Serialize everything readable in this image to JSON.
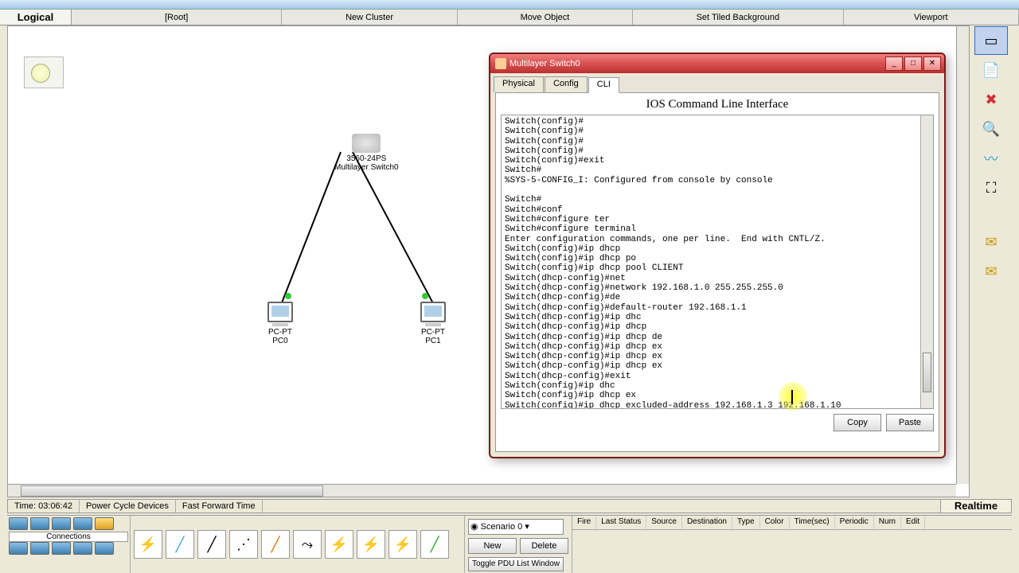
{
  "tabs": {
    "logical": "Logical",
    "root": "[Root]",
    "new_cluster": "New Cluster",
    "move_object": "Move Object",
    "set_tiled_bg": "Set Tiled Background",
    "viewport": "Viewport"
  },
  "devices": {
    "switch": {
      "model": "3560-24PS",
      "name": "Multilayer Switch0"
    },
    "pc0": {
      "type": "PC-PT",
      "name": "PC0"
    },
    "pc1": {
      "type": "PC-PT",
      "name": "PC1"
    }
  },
  "dialog": {
    "title": "Multilayer Switch0",
    "tabs": {
      "physical": "Physical",
      "config": "Config",
      "cli": "CLI"
    },
    "heading": "IOS Command Line Interface",
    "copy": "Copy",
    "paste": "Paste",
    "cli_lines": [
      "Switch(config)#",
      "Switch(config)#",
      "Switch(config)#",
      "Switch(config)#",
      "Switch(config)#exit",
      "Switch#",
      "%SYS-5-CONFIG_I: Configured from console by console",
      "",
      "Switch#",
      "Switch#conf",
      "Switch#configure ter",
      "Switch#configure terminal",
      "Enter configuration commands, one per line.  End with CNTL/Z.",
      "Switch(config)#ip dhcp",
      "Switch(config)#ip dhcp po",
      "Switch(config)#ip dhcp pool CLIENT",
      "Switch(dhcp-config)#net",
      "Switch(dhcp-config)#network 192.168.1.0 255.255.255.0",
      "Switch(dhcp-config)#de",
      "Switch(dhcp-config)#default-router 192.168.1.1",
      "Switch(dhcp-config)#ip dhc",
      "Switch(dhcp-config)#ip dhcp",
      "Switch(dhcp-config)#ip dhcp de",
      "Switch(dhcp-config)#ip dhcp ex",
      "Switch(dhcp-config)#ip dhcp ex",
      "Switch(dhcp-config)#ip dhcp ex",
      "Switch(dhcp-config)#exit",
      "Switch(config)#ip dhc",
      "Switch(config)#ip dhcp ex",
      "Switch(config)#ip dhcp excluded-address 192.168.1.3 192.168.1.10"
    ]
  },
  "status": {
    "time": "Time: 03:06:42",
    "power_cycle": "Power Cycle Devices",
    "fast_forward": "Fast Forward Time",
    "realtime": "Realtime"
  },
  "bottom": {
    "connections": "Connections",
    "scenario": "Scenario 0",
    "new": "New",
    "delete": "Delete",
    "toggle_pdu": "Toggle PDU List Window",
    "headers": [
      "Fire",
      "Last Status",
      "Source",
      "Destination",
      "Type",
      "Color",
      "Time(sec)",
      "Periodic",
      "Num",
      "Edit"
    ]
  }
}
